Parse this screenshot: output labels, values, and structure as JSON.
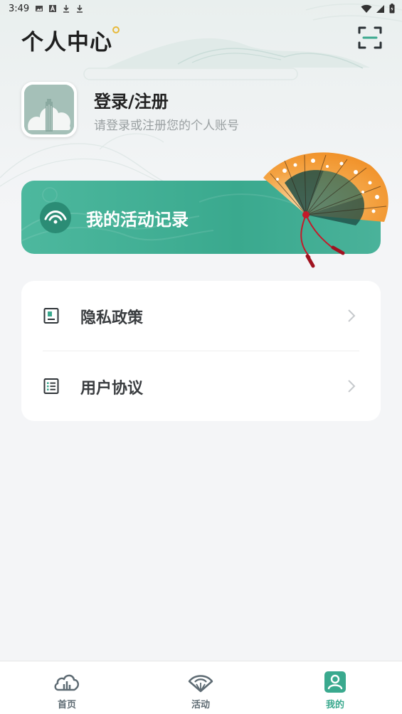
{
  "status_bar": {
    "time": "3:49"
  },
  "header": {
    "title": "个人中心"
  },
  "profile": {
    "title": "登录/注册",
    "subtitle": "请登录或注册您的个人账号"
  },
  "activity": {
    "label": "我的活动记录"
  },
  "menu": {
    "items": [
      {
        "label": "隐私政策",
        "icon": "privacy-doc-icon"
      },
      {
        "label": "用户协议",
        "icon": "agreement-list-icon"
      }
    ]
  },
  "tabbar": {
    "tabs": [
      {
        "label": "首页",
        "icon": "cloud-city-icon",
        "active": false
      },
      {
        "label": "活动",
        "icon": "fan-icon",
        "active": false
      },
      {
        "label": "我的",
        "icon": "user-icon",
        "active": true
      }
    ]
  },
  "colors": {
    "accent": "#3aa98e",
    "background": "#f4f5f7",
    "title_dot": "#e7b93a",
    "fan_orange": "#f08a1c",
    "tassel_red": "#c41a2a"
  }
}
